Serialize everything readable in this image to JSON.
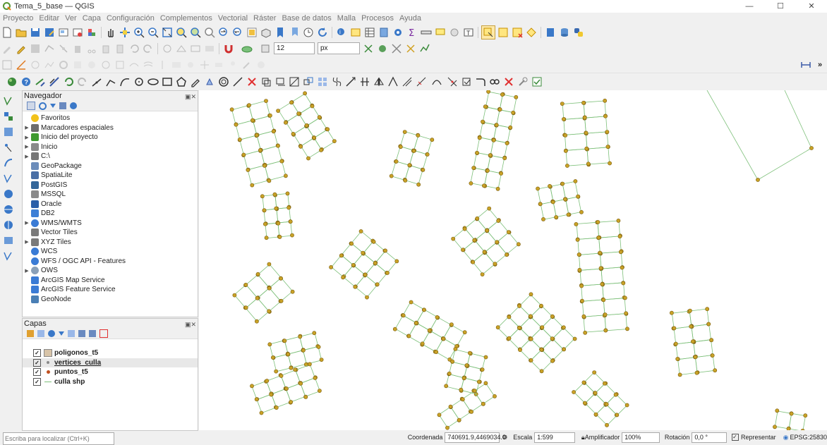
{
  "window": {
    "title": "Tema_5_base — QGIS",
    "minimize": "—",
    "maximize": "☐",
    "close": "✕"
  },
  "menu": [
    "Proyecto",
    "Editar",
    "Ver",
    "Capa",
    "Configuración",
    "Complementos",
    "Vectorial",
    "Ráster",
    "Base de datos",
    "Malla",
    "Procesos",
    "Ayuda"
  ],
  "toolbar2": {
    "size_value": "12",
    "unit_value": "px"
  },
  "navigator": {
    "title": "Navegador",
    "items": [
      {
        "label": "Favoritos",
        "icon": "star-icon",
        "color": "#f2c21b",
        "expand": false
      },
      {
        "label": "Marcadores espaciales",
        "icon": "bookmark-folder-icon",
        "color": "#6d6d6d",
        "expand": true
      },
      {
        "label": "Inicio del proyecto",
        "icon": "project-home-icon",
        "color": "#3e9a2f",
        "expand": true
      },
      {
        "label": "Inicio",
        "icon": "home-folder-icon",
        "color": "#8a8a8a",
        "expand": true
      },
      {
        "label": "C:\\",
        "icon": "drive-icon",
        "color": "#777777",
        "expand": true
      },
      {
        "label": "GeoPackage",
        "icon": "geopackage-icon",
        "color": "#6b8cba",
        "expand": false
      },
      {
        "label": "SpatiaLite",
        "icon": "spatialite-icon",
        "color": "#4a6fa5",
        "expand": false
      },
      {
        "label": "PostGIS",
        "icon": "postgis-icon",
        "color": "#336699",
        "expand": false
      },
      {
        "label": "MSSQL",
        "icon": "mssql-icon",
        "color": "#8a8a8a",
        "expand": false
      },
      {
        "label": "Oracle",
        "icon": "oracle-icon",
        "color": "#2b5fa8",
        "expand": false
      },
      {
        "label": "DB2",
        "icon": "db2-icon",
        "color": "#3d7fd6",
        "expand": false
      },
      {
        "label": "WMS/WMTS",
        "icon": "wms-globe-icon",
        "color": "#3a7bd5",
        "expand": true
      },
      {
        "label": "Vector Tiles",
        "icon": "vector-tiles-icon",
        "color": "#7a7a7a",
        "expand": false
      },
      {
        "label": "XYZ Tiles",
        "icon": "xyz-tiles-icon",
        "color": "#7a7a7a",
        "expand": true
      },
      {
        "label": "WCS",
        "icon": "wcs-globe-icon",
        "color": "#3a7bd5",
        "expand": false
      },
      {
        "label": "WFS / OGC API - Features",
        "icon": "wfs-globe-icon",
        "color": "#3a7bd5",
        "expand": false
      },
      {
        "label": "OWS",
        "icon": "ows-globe-icon",
        "color": "#8aa0b8",
        "expand": true
      },
      {
        "label": "ArcGIS Map Service",
        "icon": "arcgis-map-icon",
        "color": "#3a7bd5",
        "expand": false
      },
      {
        "label": "ArcGIS Feature Service",
        "icon": "arcgis-feature-icon",
        "color": "#3a7bd5",
        "expand": false
      },
      {
        "label": "GeoNode",
        "icon": "geonode-icon",
        "color": "#4a7fb5",
        "expand": false
      }
    ]
  },
  "layers": {
    "title": "Capas",
    "items": [
      {
        "label": "poligonos_t5",
        "symbol": "polygon",
        "checked": true,
        "selected": false
      },
      {
        "label": "vertices_culla",
        "symbol": "point-small",
        "checked": true,
        "selected": true
      },
      {
        "label": "puntos_t5",
        "symbol": "point",
        "checked": true,
        "selected": false
      },
      {
        "label": "culla shp",
        "symbol": "line",
        "checked": true,
        "selected": false
      }
    ]
  },
  "colors": {
    "line": "#7ec07a",
    "point_fill": "#c9a227",
    "point_stroke": "#7a5c0d",
    "polygon": "#d8c4a8"
  },
  "status": {
    "locator_placeholder": "Escriba para localizar (Ctrl+K)",
    "coord_label": "Coordenada",
    "coord_value": "740691.9,4469034.0",
    "scale_label": "Escala",
    "scale_value": "1:599",
    "magnifier_label": "Amplificador",
    "magnifier_value": "100%",
    "rotation_label": "Rotación",
    "rotation_value": "0,0 °",
    "render_label": "Representar",
    "crs": "EPSG:25830"
  }
}
